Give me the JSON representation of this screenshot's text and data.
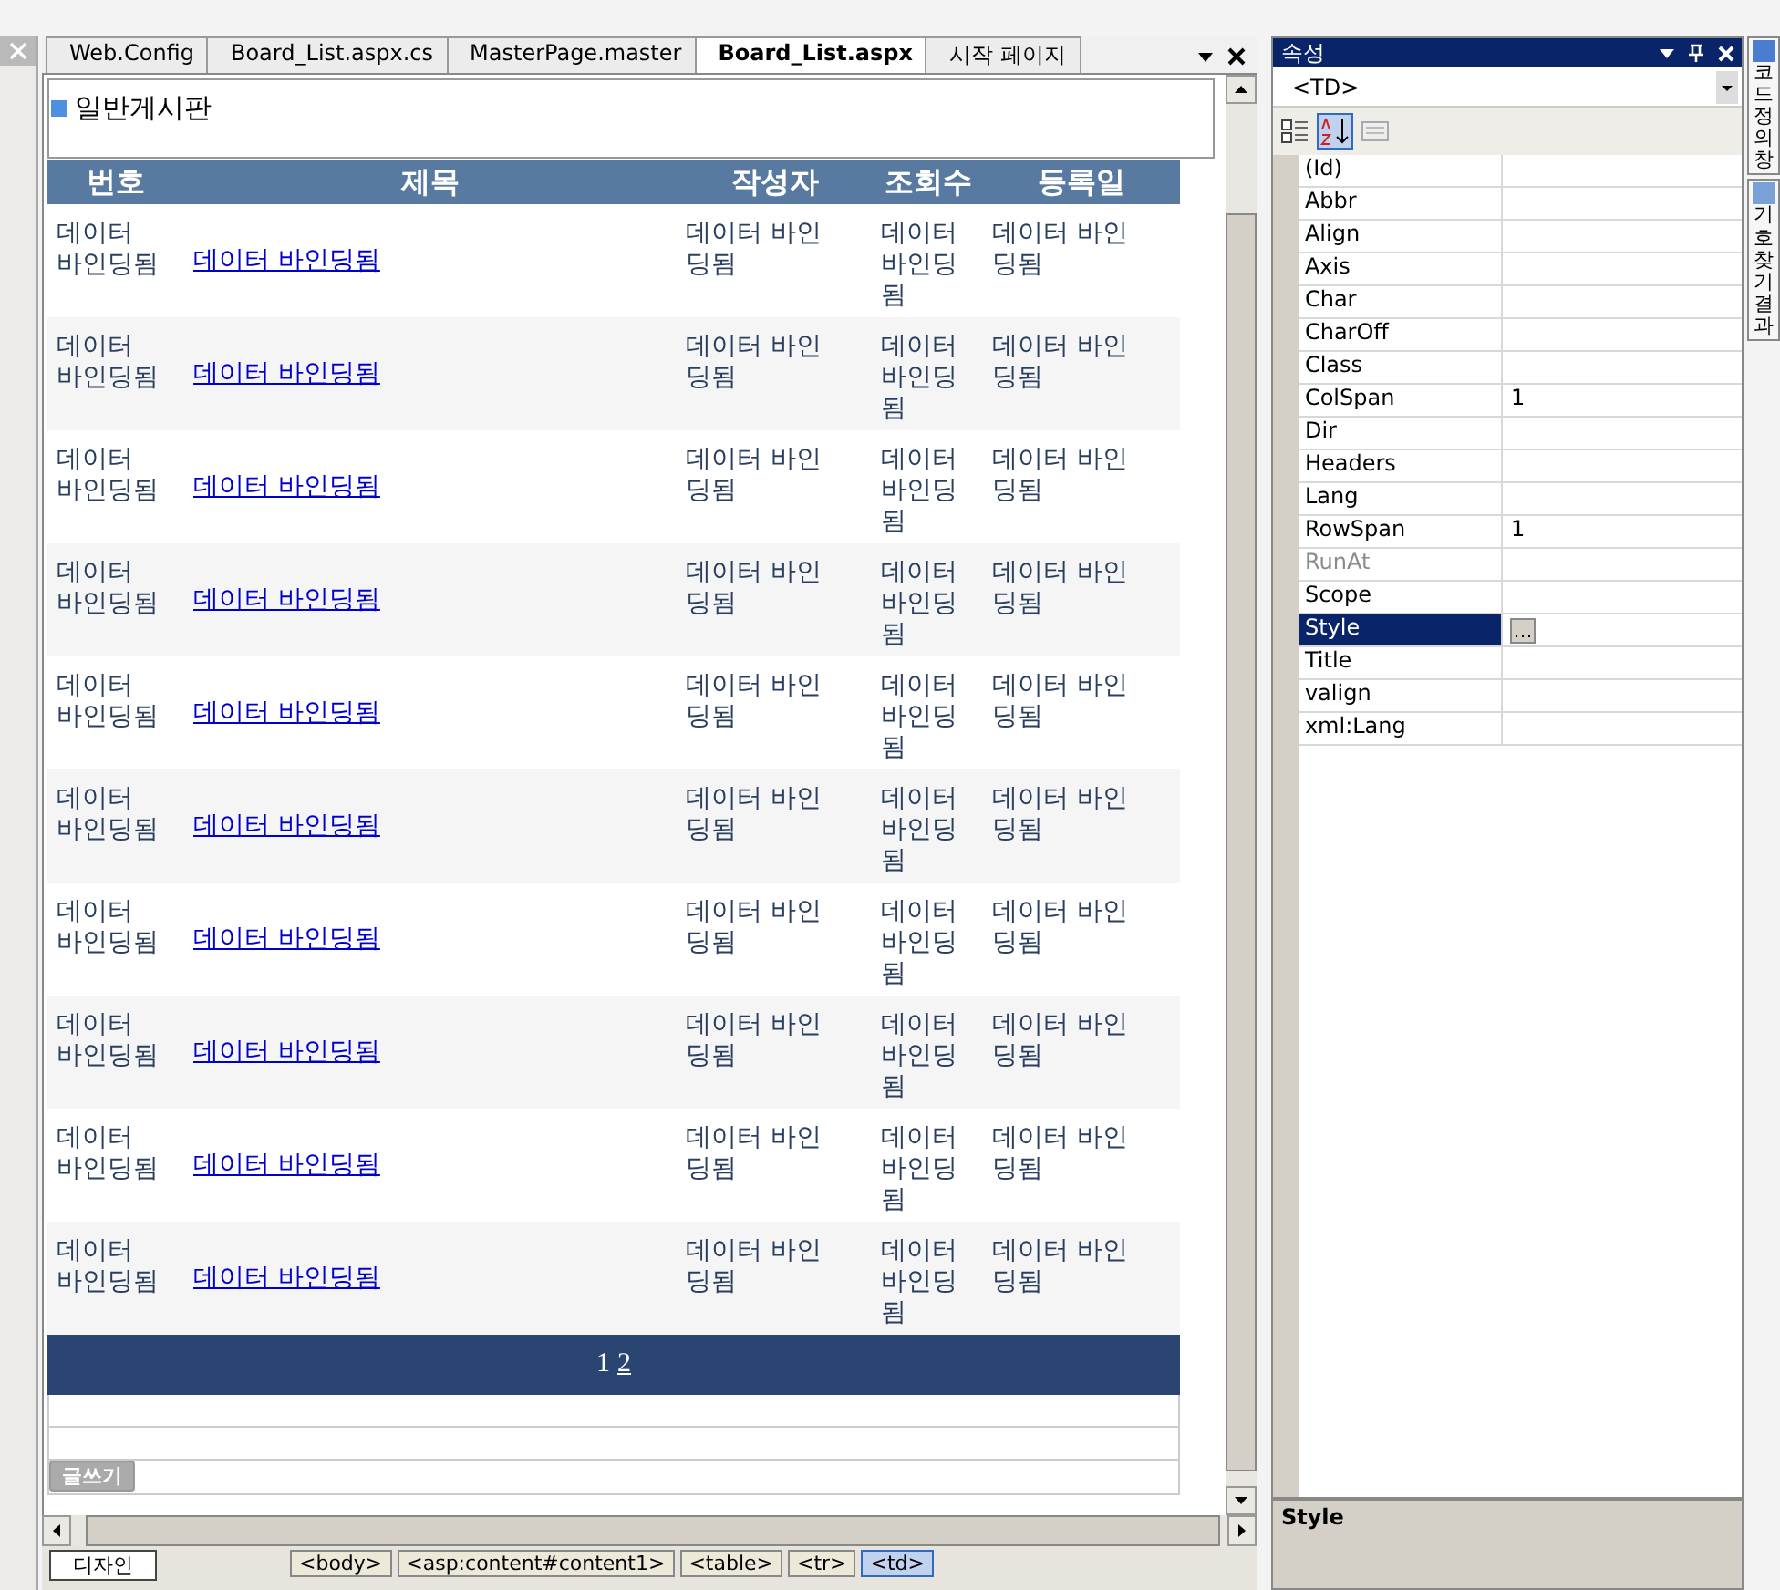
{
  "doc_tabs": [
    {
      "label": "Web.Config",
      "selected": false
    },
    {
      "label": "Board_List.aspx.cs",
      "selected": false
    },
    {
      "label": "MasterPage.master",
      "selected": false
    },
    {
      "label": "Board_List.aspx",
      "selected": true
    },
    {
      "label": "시작 페이지",
      "selected": false
    }
  ],
  "page_title": "일반게시판",
  "table": {
    "columns": [
      "번호",
      "제목",
      "작성자",
      "조회수",
      "등록일"
    ],
    "rows": [
      {
        "cells": [
          "데이터 바인딩됨",
          "데이터 바인딩됨",
          "데이터 바인딩됨",
          "데이터 바인딩됨",
          "데이터 바인딩됨"
        ]
      },
      {
        "cells": [
          "데이터 바인딩됨",
          "데이터 바인딩됨",
          "데이터 바인딩됨",
          "데이터 바인딩됨",
          "데이터 바인딩됨"
        ]
      },
      {
        "cells": [
          "데이터 바인딩됨",
          "데이터 바인딩됨",
          "데이터 바인딩됨",
          "데이터 바인딩됨",
          "데이터 바인딩됨"
        ]
      },
      {
        "cells": [
          "데이터 바인딩됨",
          "데이터 바인딩됨",
          "데이터 바인딩됨",
          "데이터 바인딩됨",
          "데이터 바인딩됨"
        ]
      },
      {
        "cells": [
          "데이터 바인딩됨",
          "데이터 바인딩됨",
          "데이터 바인딩됨",
          "데이터 바인딩됨",
          "데이터 바인딩됨"
        ]
      },
      {
        "cells": [
          "데이터 바인딩됨",
          "데이터 바인딩됨",
          "데이터 바인딩됨",
          "데이터 바인딩됨",
          "데이터 바인딩됨"
        ]
      },
      {
        "cells": [
          "데이터 바인딩됨",
          "데이터 바인딩됨",
          "데이터 바인딩됨",
          "데이터 바인딩됨",
          "데이터 바인딩됨"
        ]
      },
      {
        "cells": [
          "데이터 바인딩됨",
          "데이터 바인딩됨",
          "데이터 바인딩됨",
          "데이터 바인딩됨",
          "데이터 바인딩됨"
        ]
      },
      {
        "cells": [
          "데이터 바인딩됨",
          "데이터 바인딩됨",
          "데이터 바인딩됨",
          "데이터 바인딩됨",
          "데이터 바인딩됨"
        ]
      },
      {
        "cells": [
          "데이터 바인딩됨",
          "데이터 바인딩됨",
          "데이터 바인딩됨",
          "데이터 바인딩됨",
          "데이터 바인딩됨"
        ]
      }
    ],
    "pager": [
      "1",
      "2"
    ]
  },
  "write_button": "글쓰기",
  "bottom_bar": {
    "view_tab": "디자인",
    "breadcrumbs": [
      "<body>",
      "<asp:content#content1>",
      "<table>",
      "<tr>",
      "<td>"
    ]
  },
  "properties": {
    "title": "속성",
    "object": "<TD>",
    "items": [
      {
        "name": "(Id)",
        "value": "",
        "disabled": false,
        "selected": false
      },
      {
        "name": "Abbr",
        "value": "",
        "disabled": false,
        "selected": false
      },
      {
        "name": "Align",
        "value": "",
        "disabled": false,
        "selected": false
      },
      {
        "name": "Axis",
        "value": "",
        "disabled": false,
        "selected": false
      },
      {
        "name": "Char",
        "value": "",
        "disabled": false,
        "selected": false
      },
      {
        "name": "CharOff",
        "value": "",
        "disabled": false,
        "selected": false
      },
      {
        "name": "Class",
        "value": "",
        "disabled": false,
        "selected": false
      },
      {
        "name": "ColSpan",
        "value": "1",
        "disabled": false,
        "selected": false
      },
      {
        "name": "Dir",
        "value": "",
        "disabled": false,
        "selected": false
      },
      {
        "name": "Headers",
        "value": "",
        "disabled": false,
        "selected": false
      },
      {
        "name": "Lang",
        "value": "",
        "disabled": false,
        "selected": false
      },
      {
        "name": "RowSpan",
        "value": "1",
        "disabled": false,
        "selected": false
      },
      {
        "name": "RunAt",
        "value": "",
        "disabled": true,
        "selected": false
      },
      {
        "name": "Scope",
        "value": "",
        "disabled": false,
        "selected": false
      },
      {
        "name": "Style",
        "value": "",
        "disabled": false,
        "selected": true
      },
      {
        "name": "Title",
        "value": "",
        "disabled": false,
        "selected": false
      },
      {
        "name": "valign",
        "value": "",
        "disabled": false,
        "selected": false
      },
      {
        "name": "xml:Lang",
        "value": "",
        "disabled": false,
        "selected": false
      }
    ],
    "description_title": "Style"
  },
  "side_tabs": [
    {
      "label": "코드 정의 창"
    },
    {
      "label": "기호 찾기 결과"
    }
  ]
}
